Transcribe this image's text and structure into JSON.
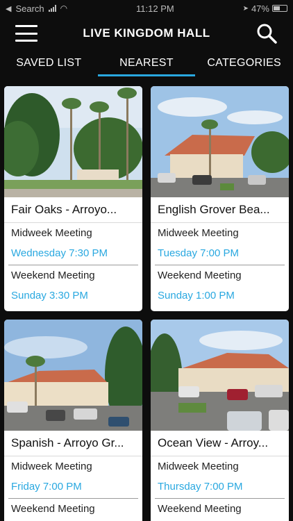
{
  "status_bar": {
    "carrier": "Search",
    "time": "11:12 PM",
    "battery": "47%"
  },
  "header": {
    "title": "LIVE KINGDOM HALL",
    "menu_icon": "hamburger-menu-icon",
    "search_icon": "search-icon"
  },
  "tabs": [
    {
      "label": "SAVED LIST",
      "active": false
    },
    {
      "label": "NEAREST",
      "active": true
    },
    {
      "label": "CATEGORIES",
      "active": false
    }
  ],
  "accent_color": "#29a8e0",
  "halls": [
    {
      "title": "Fair Oaks - Arroyo...",
      "midweek_label": "Midweek Meeting",
      "midweek_time": "Wednesday 7:30 PM",
      "weekend_label": "Weekend Meeting",
      "weekend_time": "Sunday 3:30 PM"
    },
    {
      "title": "English Grover Bea...",
      "midweek_label": "Midweek Meeting",
      "midweek_time": "Tuesday 7:00 PM",
      "weekend_label": "Weekend Meeting",
      "weekend_time": "Sunday 1:00 PM"
    },
    {
      "title": "Spanish - Arroyo Gr...",
      "midweek_label": "Midweek Meeting",
      "midweek_time": "Friday 7:00 PM",
      "weekend_label": "Weekend Meeting",
      "weekend_time": ""
    },
    {
      "title": "Ocean View - Arroy...",
      "midweek_label": "Midweek Meeting",
      "midweek_time": "Thursday 7:00 PM",
      "weekend_label": "Weekend Meeting",
      "weekend_time": ""
    }
  ]
}
